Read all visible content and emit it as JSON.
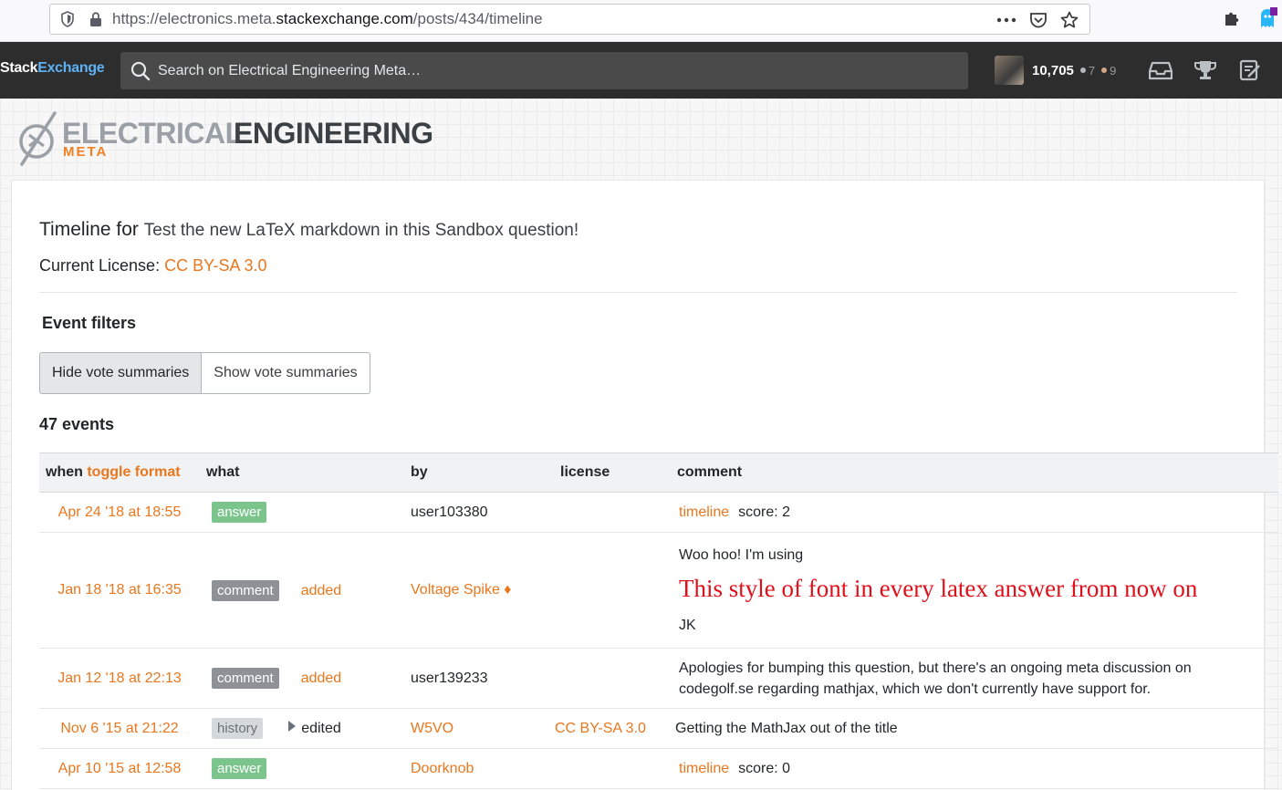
{
  "browser": {
    "url_prefix": "https://electronics.meta.",
    "url_host": "stackexchange.com",
    "url_path": "/posts/434/timeline"
  },
  "topbar": {
    "logo_stack": "Stack",
    "logo_exchange": "Exchange",
    "search_placeholder": "Search on Electrical Engineering Meta…",
    "reputation": "10,705",
    "silver_badges": "7",
    "bronze_badges": "9"
  },
  "site": {
    "logo_word_1": "ELECTRICAL",
    "logo_word_2": "ENGINEERING",
    "logo_meta": "META"
  },
  "page": {
    "title_prefix": "Timeline for",
    "question_title": "Test the new LaTeX markdown in this Sandbox question!",
    "license_label": "Current License:",
    "license_value": "CC BY-SA 3.0",
    "filters_heading": "Event filters",
    "hide_votes_label": "Hide vote summaries",
    "show_votes_label": "Show vote summaries",
    "events_count": "47 events"
  },
  "table": {
    "headers": {
      "when": "when",
      "toggle": "toggle format",
      "what": "what",
      "by": "by",
      "license": "license",
      "comment": "comment"
    },
    "rows": [
      {
        "when": "Apr 24 '18 at 18:55",
        "what_tag": "answer",
        "what_extra": "",
        "by": "user103380",
        "license": "",
        "comment_link": "timeline",
        "comment_text": "score: 2"
      },
      {
        "when": "Jan 18 '18 at 16:35",
        "what_tag": "comment",
        "what_extra": "added",
        "by": "Voltage Spike ♦",
        "license": "",
        "comment_line1": "Woo hoo! I'm using",
        "comment_big": "This style of font in every latex answer from now on",
        "comment_line3": "JK"
      },
      {
        "when": "Jan 12 '18 at 22:13",
        "what_tag": "comment",
        "what_extra": "added",
        "by": "user139233",
        "license": "",
        "comment_text": "Apologies for bumping this question, but there's an ongoing meta discussion on codegolf.se regarding mathjax, which we don't currently have support for."
      },
      {
        "when": "Nov 6 '15 at 21:22",
        "what_tag": "history",
        "what_extra": "edited",
        "by": "W5VO",
        "license": "CC BY-SA 3.0",
        "comment_text": "Getting the MathJax out of the title"
      },
      {
        "when": "Apr 10 '15 at 12:58",
        "what_tag": "answer",
        "what_extra": "",
        "by": "Doorknob",
        "license": "",
        "comment_link": "timeline",
        "comment_text": "score: 0"
      }
    ]
  }
}
